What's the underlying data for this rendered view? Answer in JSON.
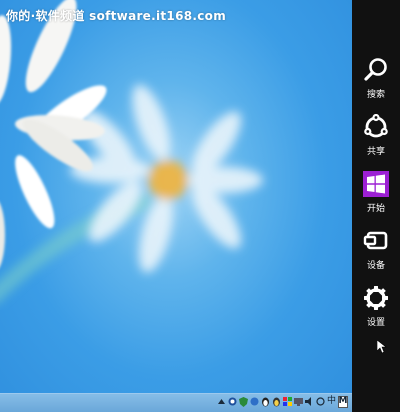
{
  "watermark": "你的·软件频道 software.it168.com",
  "charms": [
    {
      "label": "搜索",
      "icon": "search-icon"
    },
    {
      "label": "共享",
      "icon": "share-icon"
    },
    {
      "label": "开始",
      "icon": "windows-start-icon"
    },
    {
      "label": "设备",
      "icon": "devices-icon"
    },
    {
      "label": "设置",
      "icon": "settings-gear-icon"
    }
  ],
  "tray": {
    "input_method": "中",
    "m_label": "M"
  },
  "colors": {
    "charm_bar": "#111111",
    "start_accent": "#9c1fd4",
    "desktop_blue": "#3b9de6"
  }
}
